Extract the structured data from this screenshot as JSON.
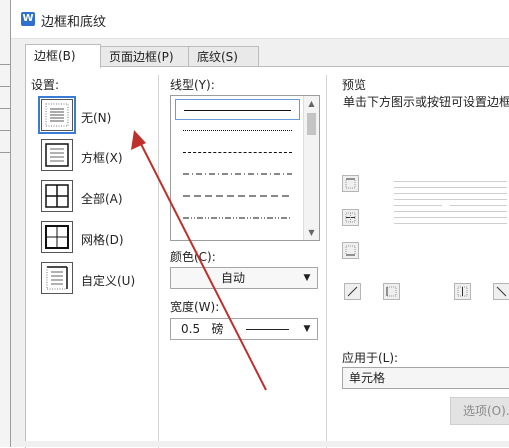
{
  "dialog": {
    "title": "边框和底纹",
    "app_icon_letter": "W"
  },
  "tabs": [
    {
      "label": "边框(B)",
      "active": true
    },
    {
      "label": "页面边框(P)",
      "active": false
    },
    {
      "label": "底纹(S)",
      "active": false
    }
  ],
  "settings": {
    "label": "设置:",
    "items": [
      {
        "label": "无(N)",
        "selected": true
      },
      {
        "label": "方框(X)",
        "selected": false
      },
      {
        "label": "全部(A)",
        "selected": false
      },
      {
        "label": "网格(D)",
        "selected": false
      },
      {
        "label": "自定义(U)",
        "selected": false
      }
    ]
  },
  "line_style": {
    "label": "线型(Y):",
    "styles": [
      "solid",
      "dotted",
      "dashed-small",
      "dash-dot",
      "dashed",
      "dash-dot-dot"
    ]
  },
  "color": {
    "label": "颜色(C):",
    "value": "自动"
  },
  "width": {
    "label": "宽度(W):",
    "value": "0.5   磅"
  },
  "preview": {
    "label": "预览",
    "hint": "单击下方图示或按钮可设置边框"
  },
  "apply_to": {
    "label": "应用于(L):",
    "value": "单元格"
  },
  "options_button": {
    "label": "选项(O)..."
  },
  "colors": {
    "accent": "#3a7bd5",
    "annotation_arrow": "#c0302b"
  }
}
